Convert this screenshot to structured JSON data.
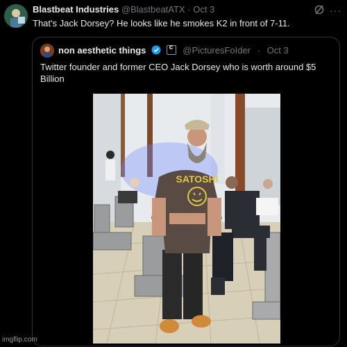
{
  "tweet": {
    "display_name": "Blastbeat Industries",
    "handle": "@BlastbeatATX",
    "separator": "·",
    "date": "Oct 3",
    "text": "That's Jack Dorsey? He looks like he smokes K2 in front of 7-11.",
    "avatar_icon": "avatar-image",
    "grok_icon": "grok-icon",
    "more_icon": "more-options-icon"
  },
  "quoted_tweet": {
    "display_name": "non aesthetic things",
    "handle": "@PicturesFoIder",
    "separator": "·",
    "date": "Oct 3",
    "text": "Twitter founder and former CEO Jack Dorsey who is worth around $5 Billion",
    "verified_color": "#1d9bf0"
  },
  "photo": {
    "shirt_text": "SATOSHI"
  },
  "watermark": "imgflip.com"
}
